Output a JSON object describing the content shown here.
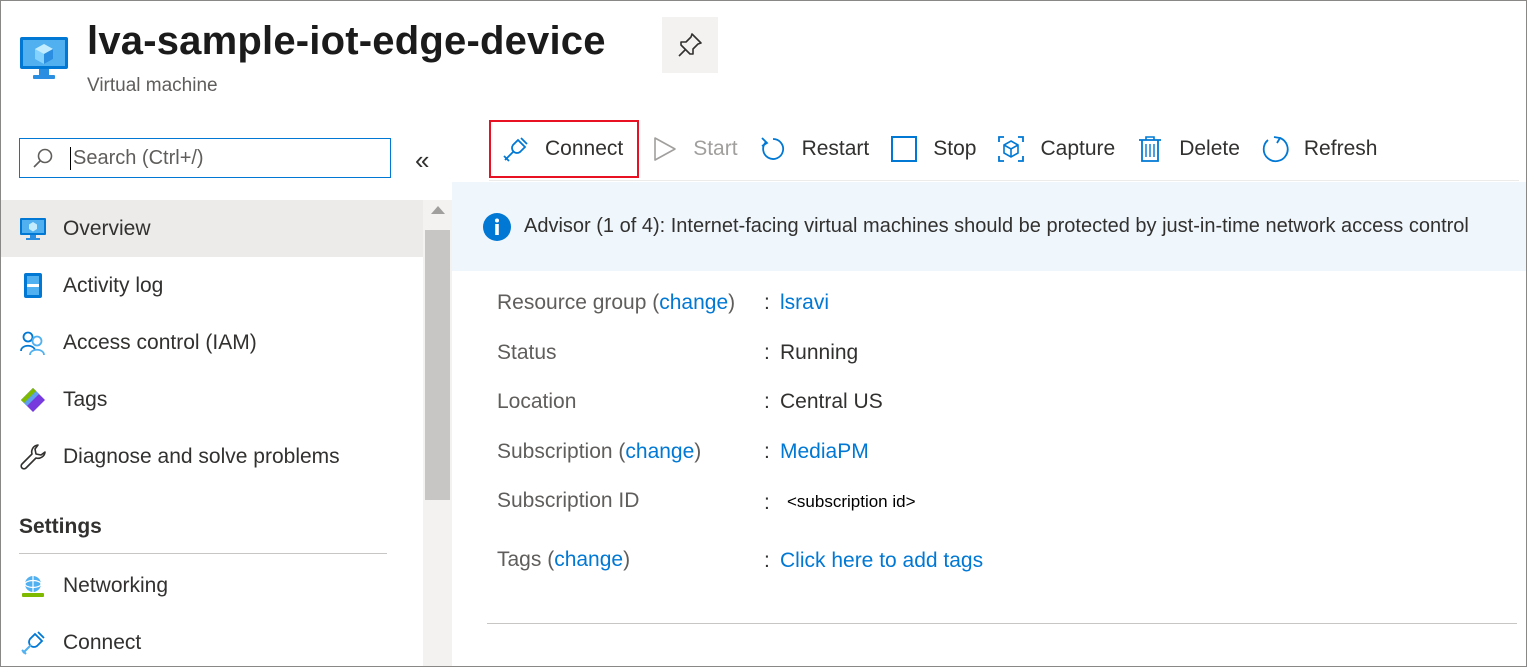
{
  "header": {
    "title": "lva-sample-iot-edge-device",
    "subtitle": "Virtual machine"
  },
  "sidebar": {
    "search_placeholder": "Search (Ctrl+/)",
    "collapse_glyph": "«",
    "items": [
      {
        "label": "Overview",
        "icon": "vm-icon",
        "selected": true
      },
      {
        "label": "Activity log",
        "icon": "activity-log-icon"
      },
      {
        "label": "Access control (IAM)",
        "icon": "people-icon"
      },
      {
        "label": "Tags",
        "icon": "tag-icon"
      },
      {
        "label": "Diagnose and solve problems",
        "icon": "wrench-icon"
      }
    ],
    "group_settings": "Settings",
    "settings_items": [
      {
        "label": "Networking",
        "icon": "networking-icon"
      },
      {
        "label": "Connect",
        "icon": "plug-icon"
      }
    ]
  },
  "toolbar": {
    "connect": "Connect",
    "start": "Start",
    "restart": "Restart",
    "stop": "Stop",
    "capture": "Capture",
    "delete": "Delete",
    "refresh": "Refresh"
  },
  "advisor": {
    "text": "Advisor (1 of 4): Internet-facing virtual machines should be protected by just-in-time network access control"
  },
  "essentials": {
    "resource_group_label": "Resource group",
    "resource_group_value": "lsravi",
    "status_label": "Status",
    "status_value": "Running",
    "location_label": "Location",
    "location_value": "Central US",
    "subscription_label": "Subscription",
    "subscription_value": "MediaPM",
    "subscription_id_label": "Subscription ID",
    "subscription_id_value": "<subscription id>",
    "tags_label": "Tags",
    "tags_value": "Click here to add tags",
    "change_link": "change",
    "colon": ":"
  },
  "colors": {
    "accent": "#0078d4",
    "highlight_border": "#e81123",
    "advisor_bg": "#eff6fc",
    "selected_bg": "#edebe9"
  }
}
